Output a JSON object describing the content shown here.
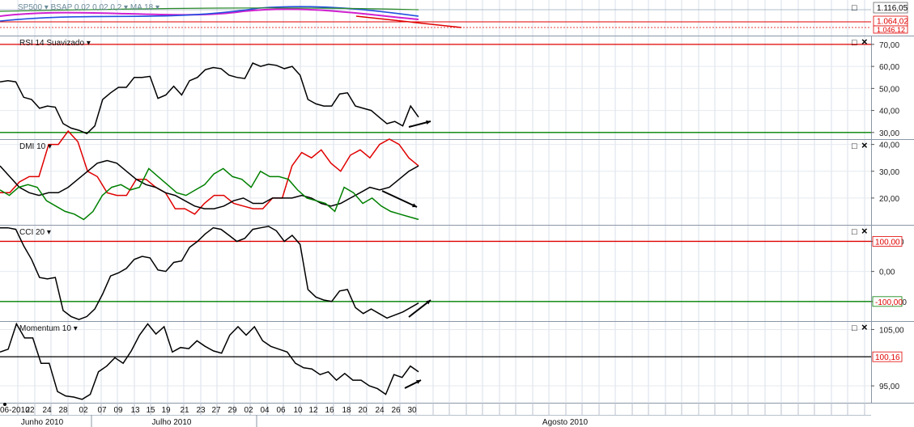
{
  "window": {
    "header_label": "SP500 ▾   BSAP 0,02  0,02  0,2 ▾   MA 18 ▾",
    "price_tags": [
      "1.116,05",
      "1.064,02",
      "1.046,12"
    ]
  },
  "panels": [
    {
      "id": "rsi",
      "label": "RSI 14 Suavizado ▾"
    },
    {
      "id": "dmi",
      "label": "DMI 10 ▾"
    },
    {
      "id": "cci",
      "label": "CCI 20 ▾"
    },
    {
      "id": "momentum",
      "label": "Momentum 10 ▾"
    }
  ],
  "window_controls": {
    "maximize": "□",
    "close": "×"
  },
  "xaxis": {
    "day_labels": [
      "06-2010",
      "22",
      "24",
      "28",
      "02",
      "07",
      "09",
      "13",
      "15",
      "19",
      "21",
      "23",
      "27",
      "29",
      "02",
      "04",
      "06",
      "10",
      "12",
      "16",
      "18",
      "20",
      "24",
      "26",
      "30"
    ],
    "month_labels": [
      "Junho 2010",
      "Julho 2010",
      "Agosto 2010"
    ]
  },
  "chart_data": [
    {
      "type": "line",
      "id": "rsi",
      "title": "RSI 14 Suavizado",
      "ylim": [
        27,
        74
      ],
      "yticks": [
        "70,00",
        "60,00",
        "50,00",
        "40,00",
        "30,00"
      ],
      "yticks_values": [
        70,
        60,
        50,
        40,
        30
      ],
      "reference_lines": [
        {
          "value": 70,
          "color": "#e00000"
        },
        {
          "value": 30,
          "color": "#008000"
        }
      ],
      "series": [
        {
          "color": "#000000",
          "values": [
            53,
            53.5,
            53,
            46,
            45,
            41,
            42,
            41.5,
            34,
            32,
            31,
            29.5,
            33,
            45,
            48,
            50.5,
            50.5,
            55,
            55,
            55.5,
            45.5,
            47,
            51,
            47,
            53.5,
            55,
            58.5,
            59.5,
            59,
            56,
            55,
            54.5,
            61.5,
            60,
            61,
            60.5,
            59,
            60,
            56,
            45,
            43,
            42,
            42,
            47.5,
            48,
            42,
            41,
            40,
            37,
            34,
            35,
            33,
            42,
            37
          ]
        }
      ]
    },
    {
      "type": "line",
      "id": "dmi",
      "title": "DMI 10",
      "ylim": [
        10,
        42
      ],
      "yticks": [
        "40,00",
        "30,00",
        "20,00"
      ],
      "yticks_values": [
        40,
        30,
        20
      ],
      "series": [
        {
          "color": "#e00000",
          "values": [
            22,
            22,
            26,
            28,
            28,
            40,
            40,
            45,
            41,
            30,
            28,
            22,
            21,
            21,
            27,
            27,
            24,
            22,
            16,
            16,
            14,
            18,
            21,
            21,
            18,
            17,
            16,
            16,
            20,
            20,
            32,
            37,
            35,
            38,
            33,
            30,
            36,
            38,
            35,
            40,
            42,
            40,
            35,
            32
          ]
        },
        {
          "color": "#000000",
          "values": [
            32,
            28,
            24,
            22,
            21,
            22,
            22,
            24,
            27,
            30,
            33,
            34,
            33,
            30,
            27,
            25,
            24,
            22,
            21,
            19,
            17,
            16,
            16,
            17,
            19,
            20,
            18,
            18,
            20,
            20,
            20,
            21,
            20,
            18,
            17,
            18,
            20,
            22,
            24,
            23,
            24,
            27,
            30,
            32
          ]
        },
        {
          "color": "#008000",
          "values": [
            23,
            21,
            24,
            25,
            24,
            19,
            17,
            15,
            14,
            12,
            15,
            21,
            24,
            25,
            23,
            24,
            31,
            28,
            25,
            22,
            21,
            23,
            25,
            29,
            31,
            28,
            27,
            24,
            30,
            28,
            28,
            27,
            23,
            20,
            19,
            18,
            15,
            24,
            22,
            18,
            20,
            17,
            15,
            14,
            13,
            12
          ]
        }
      ]
    },
    {
      "type": "line",
      "id": "cci",
      "title": "CCI 20",
      "ylim": [
        -165,
        155
      ],
      "yticks": [
        "100,00",
        "0,00",
        "-100,00"
      ],
      "yticks_values": [
        100,
        0,
        -100
      ],
      "reference_lines": [
        {
          "value": 100,
          "color": "#e00000"
        },
        {
          "value": -100,
          "color": "#008000"
        }
      ],
      "value_tags": [
        {
          "value": 100,
          "text": "100,00"
        },
        {
          "value": -100,
          "text": "-100,00"
        }
      ],
      "series": [
        {
          "color": "#000000",
          "values": [
            145,
            145,
            140,
            85,
            40,
            -20,
            -25,
            -20,
            -130,
            -150,
            -160,
            -150,
            -125,
            -75,
            -15,
            -5,
            10,
            40,
            50,
            45,
            5,
            0,
            30,
            35,
            80,
            100,
            125,
            145,
            140,
            120,
            100,
            110,
            140,
            145,
            150,
            135,
            100,
            120,
            90,
            -60,
            -85,
            -95,
            -100,
            -65,
            -60,
            -120,
            -140,
            -125,
            -140,
            -155,
            -145,
            -135,
            -120,
            -105
          ]
        }
      ]
    },
    {
      "type": "line",
      "id": "momentum",
      "title": "Momentum 10",
      "ylim": [
        92,
        106.5
      ],
      "yticks": [
        "105,00",
        "95,00"
      ],
      "yticks_values": [
        105,
        95
      ],
      "reference_lines": [
        {
          "value": 100.16,
          "color": "#000000"
        }
      ],
      "value_tags": [
        {
          "value": 100.16,
          "text": "100,16"
        }
      ],
      "series": [
        {
          "color": "#000000",
          "values": [
            101,
            101.5,
            106,
            103.5,
            103.5,
            99,
            99,
            94,
            93.2,
            93,
            92.6,
            93.5,
            97.5,
            98.5,
            100,
            99,
            101.2,
            104,
            106,
            104.2,
            105.5,
            101,
            101.8,
            101.6,
            103,
            102,
            101.2,
            100.8,
            104,
            105.5,
            104,
            105.5,
            103,
            102,
            101.5,
            101,
            99,
            98.2,
            98,
            97,
            97.5,
            96,
            97.2,
            96,
            96,
            95,
            94.5,
            93.5,
            97,
            96.5,
            98.5,
            97.5
          ]
        }
      ]
    }
  ]
}
